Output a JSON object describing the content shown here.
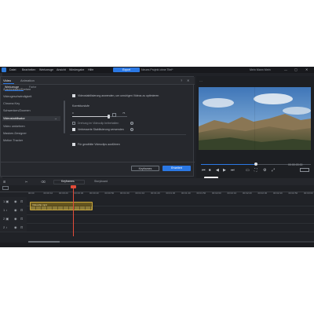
{
  "menubar": {
    "items": [
      "Datei",
      "Bearbeiten",
      "Werkzeuge",
      "Ansicht",
      "Wiedergabe",
      "Hilfe"
    ],
    "project_button": "Export",
    "project_name": "Neues Projekt ohne Titel*",
    "user": "Mein Mann Mein",
    "window_controls": [
      "—",
      "▢",
      "✕"
    ]
  },
  "dialog": {
    "tabs": [
      "Video",
      "Animation"
    ],
    "active_tab": "Video",
    "help": "?",
    "close": "✕",
    "sub_tabs": [
      "Werkzeuge",
      "Farbe"
    ],
    "list": [
      "Zuschneiden/Drehen",
      "Videogeschwindigkeit",
      "Chroma Key",
      "Schwenken/Zoomen",
      "Videostabilisator",
      "Video umkehren",
      "Masken-Designer",
      "Motion Tracker"
    ],
    "selected_item": "Videostabilisator",
    "selected_arrow": "→",
    "options": {
      "enable_label": "Videostabilisierung anwenden, um unruhigen Videos zu optimieren",
      "correction_label": "Korrekturstufe",
      "slider_min": "0",
      "slider_max": "75",
      "slider_value": 0.66,
      "keep_audio_label": "Drehung im Videoclip beibehalten",
      "enhanced_label": "Verbesserte Stabilisierung verwenden",
      "apply_all_label": "Für gewählte Videoclips ausführen"
    },
    "keyframes_button": "Keyframes",
    "ok_button": "Erweitert"
  },
  "preview": {
    "timecode": "00:00:03:00",
    "tooltip": "Nächster Frame",
    "progress": 0.5,
    "controls": [
      "⏮",
      "⏹",
      "◀",
      "▶",
      "⏭"
    ],
    "right_controls": [
      "▭",
      "⛶",
      "⚙",
      "⤢"
    ]
  },
  "timeline": {
    "toolbar_icons": [
      "⊞",
      "✂",
      "⌫"
    ],
    "tabs": [
      "Keyframes",
      "Storyboard"
    ],
    "ticks": [
      "00:00",
      "00:00:10",
      "00:00:20",
      "00:00:30",
      "00:00:40",
      "00:00:50",
      "00:01:00",
      "00:01:10",
      "00:01:20",
      "00:01:30",
      "00:01:40",
      "00:01:50",
      "00:02:00",
      "00:02:10",
      "00:02:20",
      "00:02:30",
      "00:02:40",
      "00:02:50",
      "00:03:00"
    ],
    "clip_name": "Videoclip.mp4",
    "track_icons": [
      "1 ▣",
      "1 ♪",
      "2 ▣",
      "2 ♪"
    ]
  }
}
